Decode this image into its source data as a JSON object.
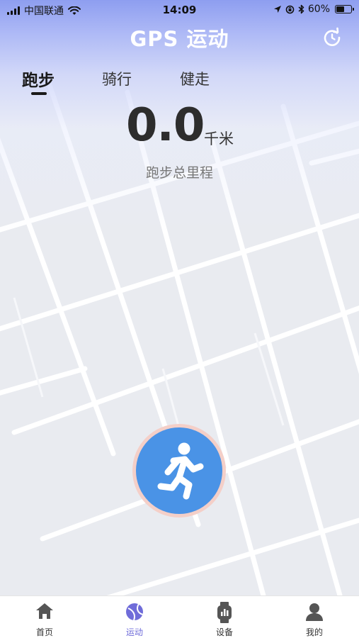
{
  "status_bar": {
    "carrier": "中国联通",
    "time": "14:09",
    "battery_percent": "60%",
    "battery_level": 0.6
  },
  "header": {
    "title": "GPS 运动",
    "refresh_icon": "refresh-icon"
  },
  "tabs": [
    {
      "label": "跑步",
      "active": true
    },
    {
      "label": "骑行",
      "active": false
    },
    {
      "label": "健走",
      "active": false
    }
  ],
  "stats": {
    "distance_value": "0.0",
    "distance_unit": "千米",
    "distance_label": "跑步总里程"
  },
  "start_button": {
    "icon": "running-person-icon",
    "color": "#4a93e6",
    "ring_color": "#f4cfc8"
  },
  "bottom_nav": [
    {
      "label": "首页",
      "icon": "home-icon",
      "active": false
    },
    {
      "label": "运动",
      "icon": "sport-ball-icon",
      "active": true
    },
    {
      "label": "设备",
      "icon": "watch-icon",
      "active": false
    },
    {
      "label": "我的",
      "icon": "user-icon",
      "active": false
    }
  ],
  "colors": {
    "header_gradient_top": "#8e9ef0",
    "accent": "#6f6cd9",
    "map_background": "#e9ebf0"
  }
}
